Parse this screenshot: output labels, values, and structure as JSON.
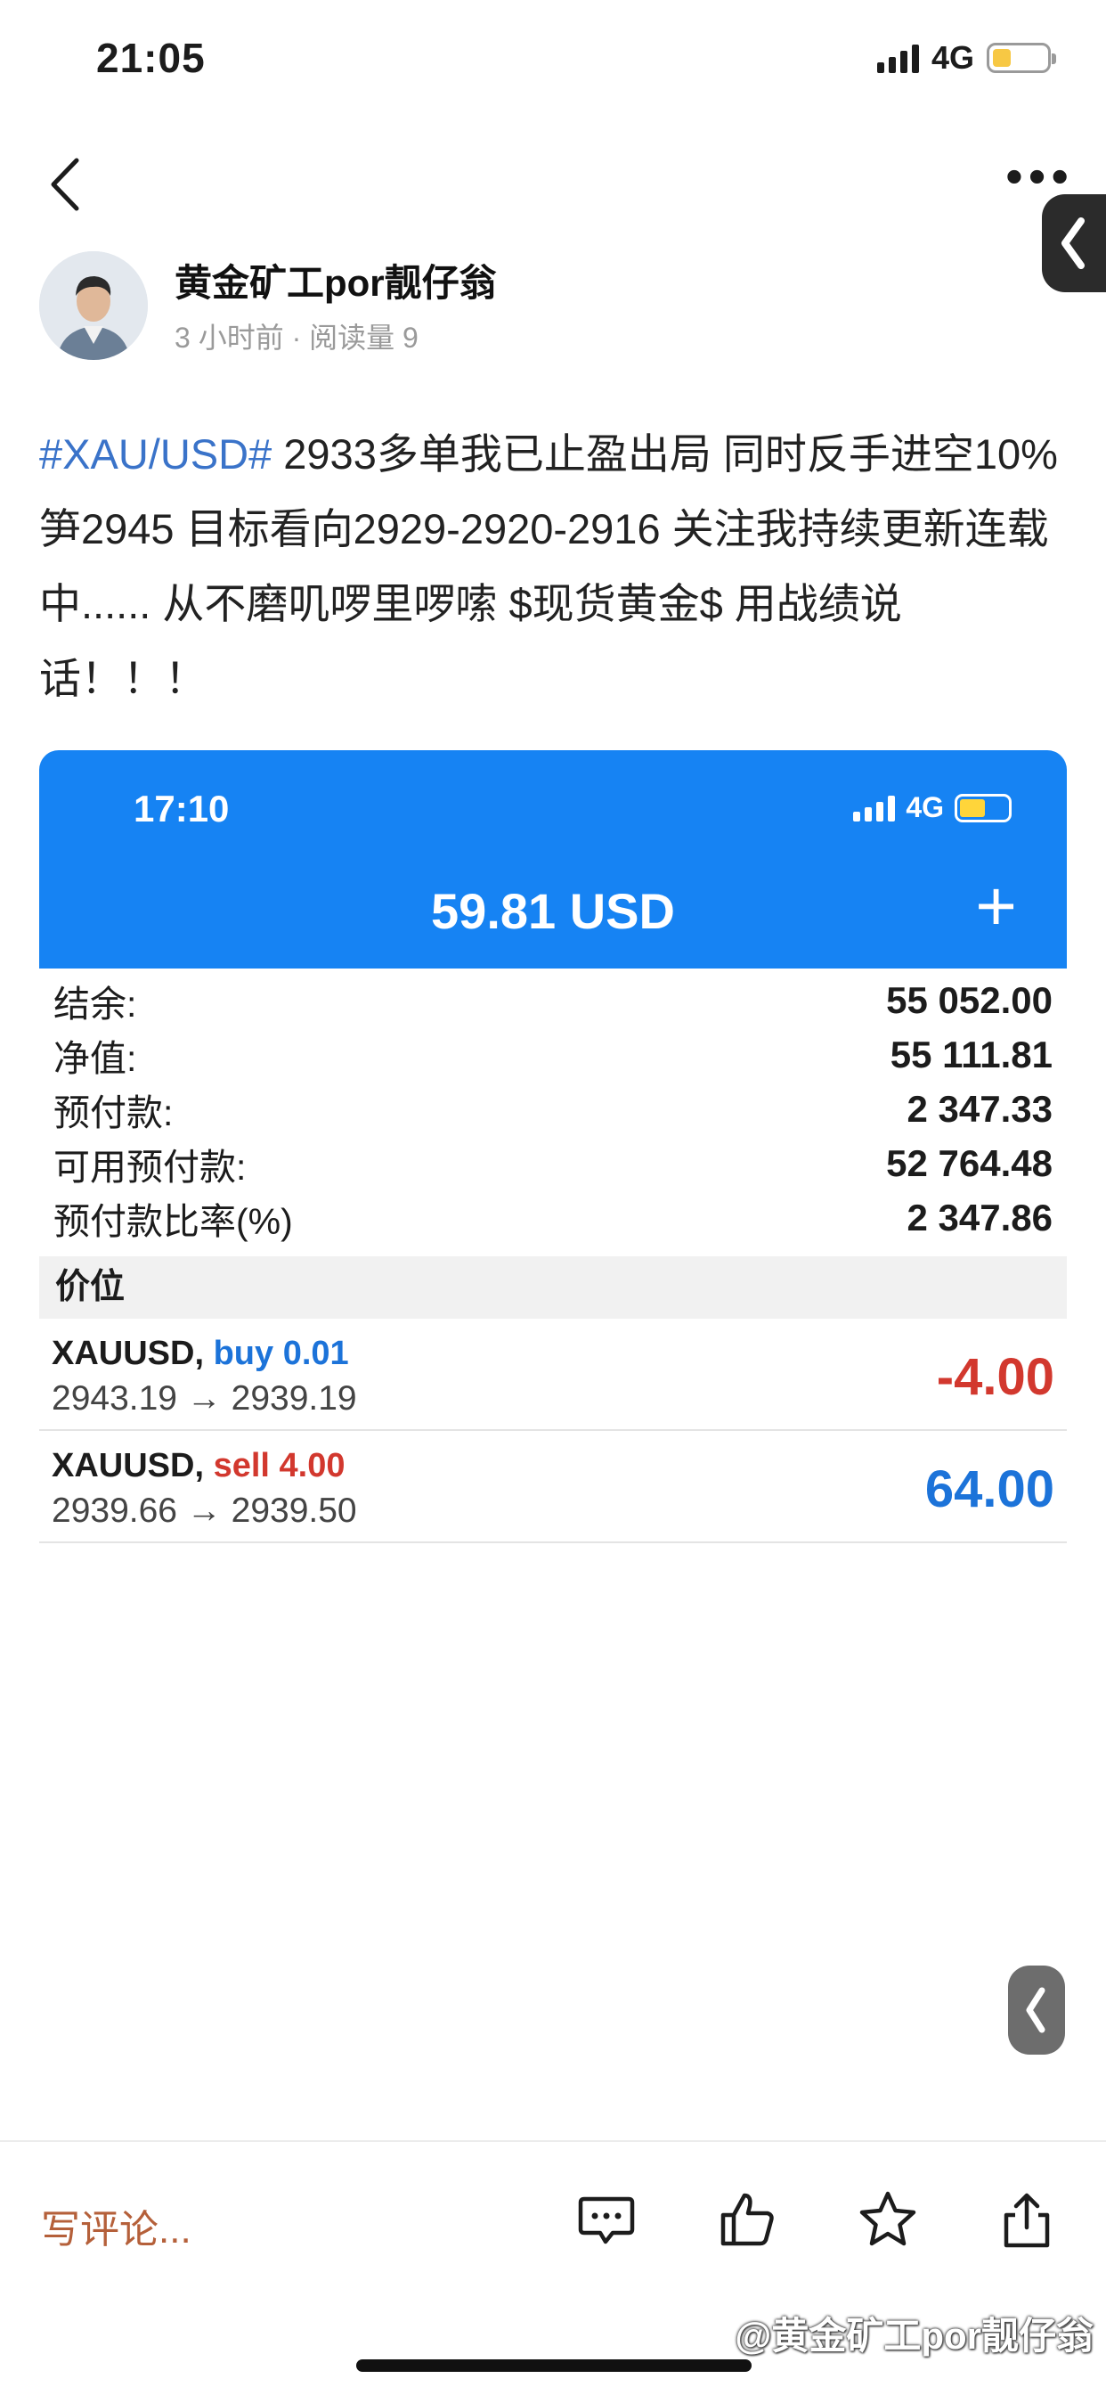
{
  "status_bar": {
    "time": "21:05",
    "network": "4G"
  },
  "author": {
    "name": "黄金矿工por靓仔翁",
    "meta": "3 小时前 · 阅读量 9"
  },
  "post": {
    "hashtag": "#XAU/USD#",
    "text": " 2933多单我已止盈出局 同时反手进空10% 笋2945 目标看向2929-2920-2916 关注我持续更新连载中...... 从不磨叽啰里啰嗦 $现货黄金$ 用战绩说话！！！"
  },
  "screenshot": {
    "status_time": "17:10",
    "status_network": "4G",
    "balance_title": "59.81 USD",
    "plus_label": "+",
    "account": [
      {
        "label": "结余:",
        "value": "55 052.00"
      },
      {
        "label": "净值:",
        "value": "55 111.81"
      },
      {
        "label": "预付款:",
        "value": "2 347.33"
      },
      {
        "label": "可用预付款:",
        "value": "52 764.48"
      },
      {
        "label": "预付款比率(%)",
        "value": "2 347.86"
      }
    ],
    "section_title": "价位",
    "positions": [
      {
        "symbol": "XAUUSD,",
        "side": "buy 0.01",
        "prices": "2943.19 → 2939.19",
        "profit": "-4.00"
      },
      {
        "symbol": "XAUUSD,",
        "side": "sell 4.00",
        "prices": "2939.66 → 2939.50",
        "profit": "64.00"
      }
    ]
  },
  "bottom_bar": {
    "comment_placeholder": "写评论..."
  },
  "watermark": "@黄金矿工por靓仔翁"
}
